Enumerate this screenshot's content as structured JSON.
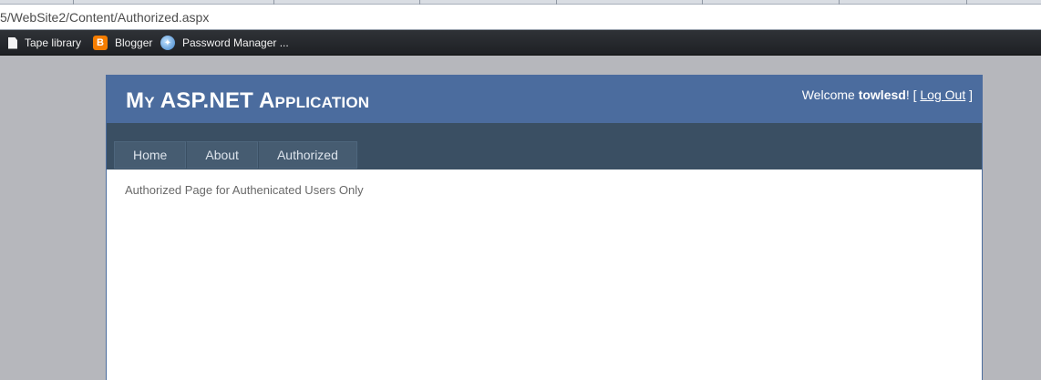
{
  "browser": {
    "address": "5/WebSite2/Content/Authorized.aspx",
    "bookmarks": [
      {
        "label": "Tape library",
        "icon": "page-icon"
      },
      {
        "label": "Blogger",
        "icon": "blogger-icon"
      },
      {
        "label": "Password Manager ...",
        "icon": "password-manager-icon"
      }
    ]
  },
  "header": {
    "title": "My ASP.NET Application",
    "welcome_prefix": "Welcome",
    "username": "towlesd",
    "welcome_suffix": "! [",
    "logout_label": "Log Out",
    "close_bracket": "]"
  },
  "menu": {
    "items": [
      {
        "label": "Home"
      },
      {
        "label": "About"
      },
      {
        "label": "Authorized"
      }
    ]
  },
  "main": {
    "message": "Authorized Page for Authenicated Users Only"
  },
  "colors": {
    "header_bg": "#4b6c9e",
    "menu_bar_bg": "#3a4f63",
    "menu_item_bg": "#465c71",
    "page_bg": "#b6b7bc"
  }
}
